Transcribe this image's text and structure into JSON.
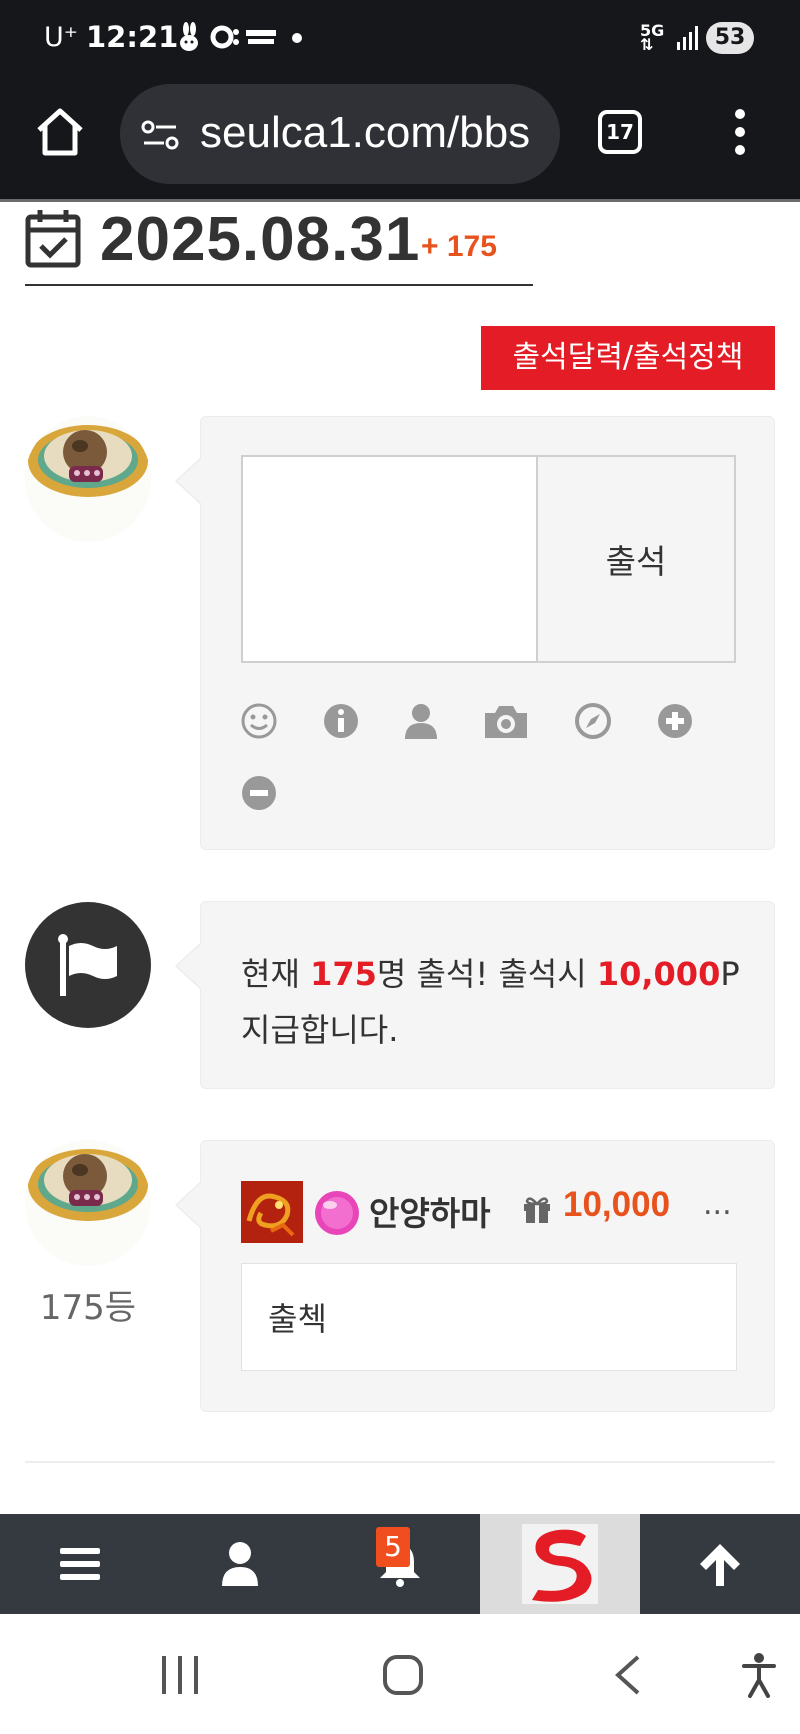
{
  "status_bar": {
    "carrier": "U⁺",
    "time": "12:21",
    "network": "5G",
    "battery": "53"
  },
  "browser": {
    "url": "seulca1.com/bbs",
    "tab_count": "17"
  },
  "header": {
    "date": "2025.08.31",
    "count": "+ 175"
  },
  "policy_button": "출석달력/출석정책",
  "attend_form": {
    "textarea_value": "",
    "submit_label": "출석",
    "toolbar_icons": [
      "smile-icon",
      "info-icon",
      "user-icon",
      "camera-icon",
      "compass-icon",
      "plus-circle-icon",
      "minus-circle-icon"
    ]
  },
  "info": {
    "prefix": "현재 ",
    "count": "175",
    "middle": "명 출석! 출석시 ",
    "points": "10,000",
    "suffix": "P",
    "line2": "지급합니다."
  },
  "comment": {
    "rank": "175등",
    "nickname": "안양하마",
    "points": "10,000",
    "more": "...",
    "text": "출첵"
  },
  "bottom_nav": {
    "notification_count": "5"
  },
  "colors": {
    "accent_red": "#e31c25",
    "accent_orange": "#e8521c",
    "nav_bg": "#343a40",
    "browser_bg": "#16171b"
  }
}
